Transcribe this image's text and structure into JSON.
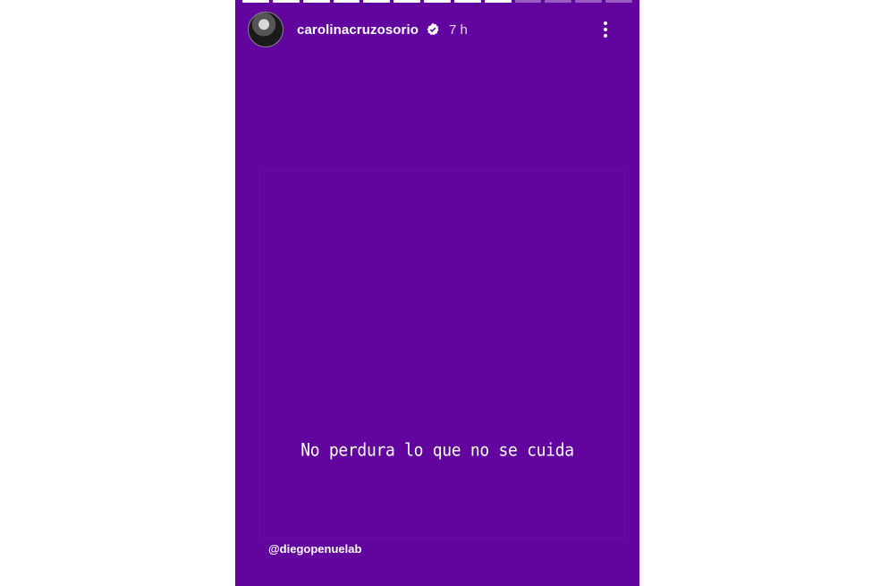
{
  "story": {
    "username": "carolinacruzosorio",
    "time": "7 h",
    "quote": "No perdura lo que no se cuida",
    "mention": "@diegopenuelab",
    "background_color": "#62049e",
    "progress": {
      "total_segments": 13,
      "completed_segments": 9
    },
    "icons": [
      "verified-badge-icon",
      "more-options-icon"
    ]
  }
}
